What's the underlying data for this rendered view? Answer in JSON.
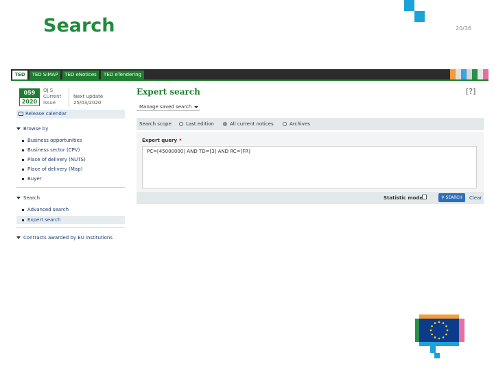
{
  "slide": {
    "title": "Search",
    "page_number": "20/36"
  },
  "top_tabs": [
    {
      "label": "TED",
      "active": true
    },
    {
      "label": "TED SIMAP",
      "active": false
    },
    {
      "label": "TED eNotices",
      "active": false
    },
    {
      "label": "TED eTendering",
      "active": false
    }
  ],
  "sidebar": {
    "oj_number": "059",
    "oj_year": "2020",
    "oj_text": [
      "OJ S",
      "Current",
      "Issue"
    ],
    "next_update": [
      "Next update",
      "25/03/2020"
    ],
    "release_calendar": "Release calendar",
    "browse_by": {
      "heading": "Browse by",
      "items": [
        "Business opportunities",
        "Business sector (CPV)",
        "Place of delivery (NUTS)",
        "Place of delivery (Map)",
        "Buyer"
      ]
    },
    "search": {
      "heading": "Search",
      "items": [
        "Advanced search",
        "Expert search"
      ]
    },
    "contracts_eu": "Contracts awarded by EU institutions"
  },
  "main": {
    "title": "Expert search",
    "help": "[?]",
    "manage_saved_search": "Manage saved search",
    "scope": {
      "label": "Search scope",
      "options": [
        "Last edition",
        "All current notices",
        "Archives"
      ],
      "selected": "All current notices"
    },
    "query": {
      "label": "Expert query",
      "required_mark": "*",
      "value": "PC=[45000000] AND TD=[3] AND RC=[FR]"
    },
    "statistic_mode": "Statistic mode",
    "search_button": "SEARCH",
    "clear": "Clear"
  },
  "colors": {
    "ted_green": "#1e7d2f",
    "title_green": "#1e8c3a",
    "accent_blue": "#1aa3d9",
    "eu_blue": "#0d3b8c",
    "eu_yellow": "#ffd617"
  }
}
